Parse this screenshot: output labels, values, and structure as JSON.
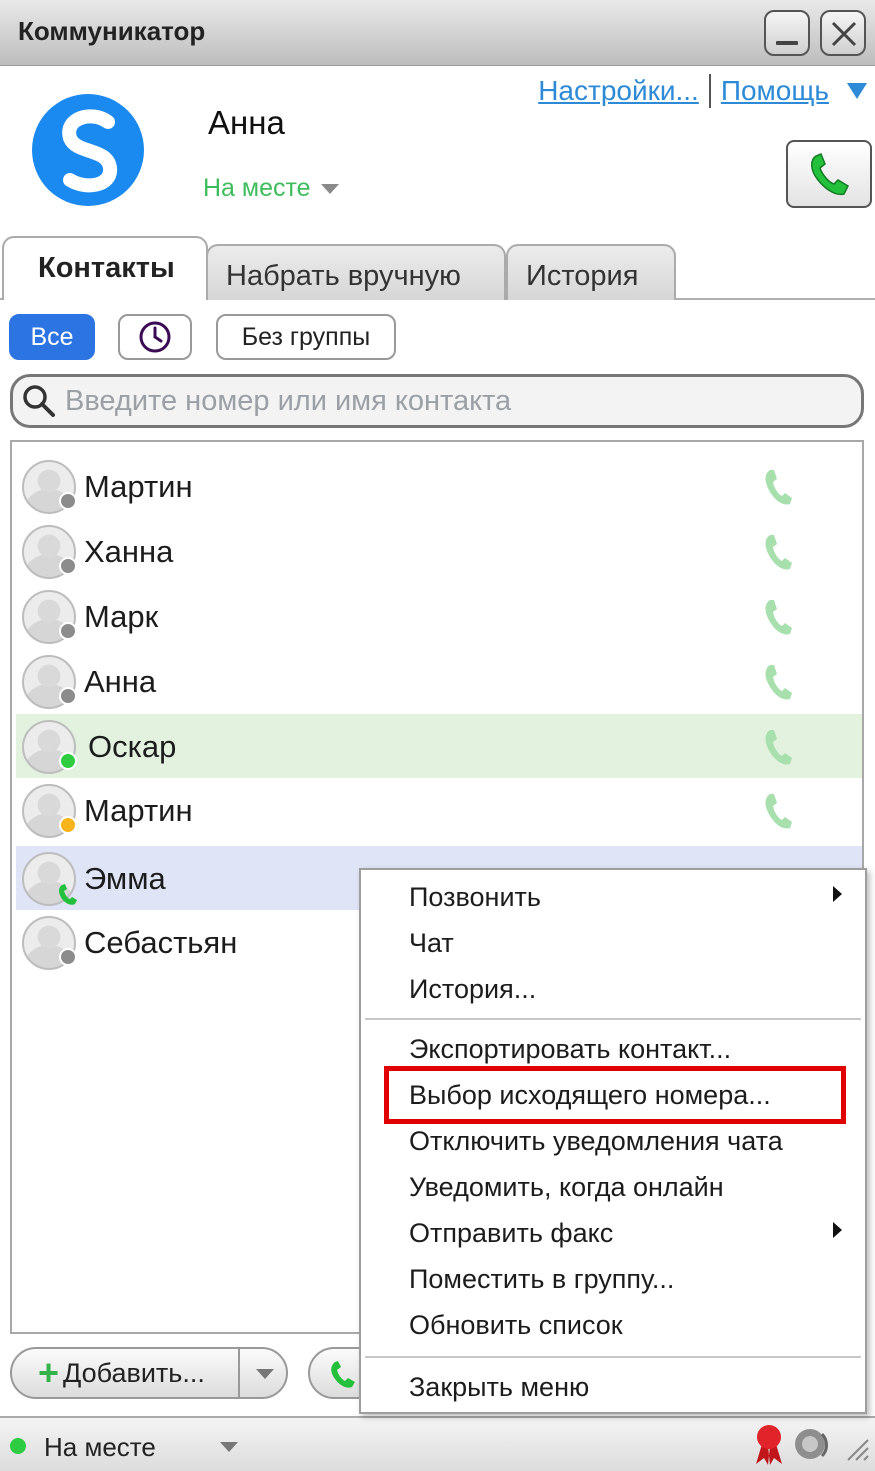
{
  "window": {
    "title": "Коммуникатор"
  },
  "header": {
    "user_name": "Анна",
    "status": "На месте",
    "settings_link": "Настройки...",
    "help_link": "Помощь"
  },
  "tabs": [
    {
      "label": "Контакты",
      "active": true
    },
    {
      "label": "Набрать вручную",
      "active": false
    },
    {
      "label": "История",
      "active": false
    }
  ],
  "filters": {
    "all": "Все",
    "no_group": "Без группы"
  },
  "search": {
    "placeholder": "Введите номер или имя контакта"
  },
  "contacts": [
    {
      "name": "Мартин",
      "presence": "offline"
    },
    {
      "name": "Ханна",
      "presence": "offline"
    },
    {
      "name": "Марк",
      "presence": "offline"
    },
    {
      "name": "Анна",
      "presence": "offline"
    },
    {
      "name": "Оскар",
      "presence": "online"
    },
    {
      "name": "Мартин",
      "presence": "away"
    },
    {
      "name": "Эмма",
      "presence": "on-call"
    },
    {
      "name": "Себастьян",
      "presence": "offline"
    }
  ],
  "context_menu": {
    "items": [
      {
        "label": "Позвонить",
        "submenu": true
      },
      {
        "label": "Чат",
        "submenu": false
      },
      {
        "label": "История...",
        "submenu": false
      },
      {
        "label": "Экспортировать контакт...",
        "submenu": false
      },
      {
        "label": "Выбор исходящего номера...",
        "submenu": false,
        "highlighted": true
      },
      {
        "label": "Отключить уведомления чата",
        "submenu": false
      },
      {
        "label": "Уведомить, когда онлайн",
        "submenu": false
      },
      {
        "label": "Отправить факс",
        "submenu": true
      },
      {
        "label": "Поместить в группу...",
        "submenu": false
      },
      {
        "label": "Обновить список",
        "submenu": false
      },
      {
        "label": "Закрыть меню",
        "submenu": false
      }
    ]
  },
  "footer": {
    "add_button": "Добавить...",
    "status": "На месте"
  },
  "colors": {
    "accent": "#2d74e3",
    "online": "#2ecc40",
    "away": "#f9b31b",
    "highlight_box": "#e00000",
    "link": "#2c8ad6"
  }
}
